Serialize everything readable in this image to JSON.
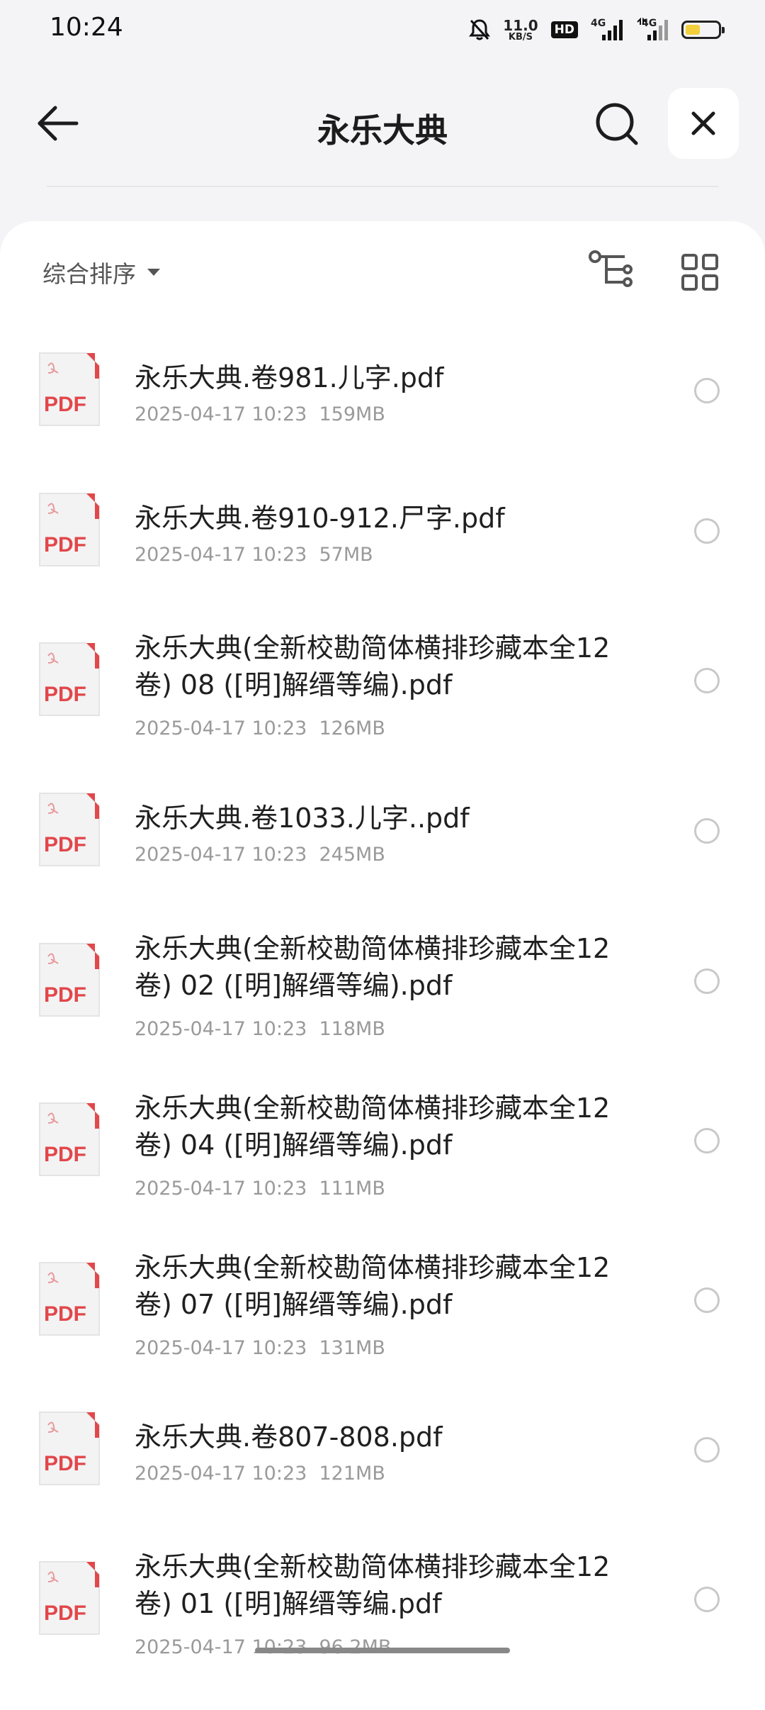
{
  "status_bar": {
    "time": "10:24",
    "net_speed_value": "11.0",
    "net_speed_unit": "KB/S",
    "hd_badge": "HD",
    "signal_label_1": "4G",
    "signal_label_2": "4G",
    "battery_level": 0.45,
    "icons": [
      "bell-off-icon",
      "hd-icon",
      "signal-icon",
      "signal-icon",
      "battery-icon"
    ]
  },
  "header": {
    "title": "永乐大典",
    "icons": [
      "back-arrow-icon",
      "search-icon",
      "close-icon"
    ]
  },
  "toolbar": {
    "sort_label": "综合排序",
    "icons": [
      "dropdown-triangle-icon",
      "tree-view-icon",
      "grid-view-icon"
    ]
  },
  "pdf_icon_label": "PDF",
  "files": [
    {
      "name": "永乐大典.卷981.儿字.pdf",
      "date": "2025-04-17 10:23",
      "size": "159MB"
    },
    {
      "name": "永乐大典.卷910-912.尸字.pdf",
      "date": "2025-04-17 10:23",
      "size": "57MB"
    },
    {
      "name": "永乐大典(全新校勘简体横排珍藏本全12卷) 08 ([明]解缙等编).pdf",
      "date": "2025-04-17 10:23",
      "size": "126MB"
    },
    {
      "name": "永乐大典.卷1033.儿字..pdf",
      "date": "2025-04-17 10:23",
      "size": "245MB"
    },
    {
      "name": "永乐大典(全新校勘简体横排珍藏本全12卷) 02 ([明]解缙等编).pdf",
      "date": "2025-04-17 10:23",
      "size": "118MB"
    },
    {
      "name": "永乐大典(全新校勘简体横排珍藏本全12卷) 04 ([明]解缙等编).pdf",
      "date": "2025-04-17 10:23",
      "size": "111MB"
    },
    {
      "name": "永乐大典(全新校勘简体横排珍藏本全12卷) 07 ([明]解缙等编).pdf",
      "date": "2025-04-17 10:23",
      "size": "131MB"
    },
    {
      "name": "永乐大典.卷807-808.pdf",
      "date": "2025-04-17 10:23",
      "size": "121MB"
    },
    {
      "name": "永乐大典(全新校勘简体横排珍藏本全12卷) 01 ([明]解缙等编.pdf",
      "date": "2025-04-17 10:23",
      "size": "96.2MB"
    }
  ],
  "colors": {
    "pdf_red": "#e2474a",
    "background": "#f4f4f6",
    "card": "#ffffff"
  }
}
